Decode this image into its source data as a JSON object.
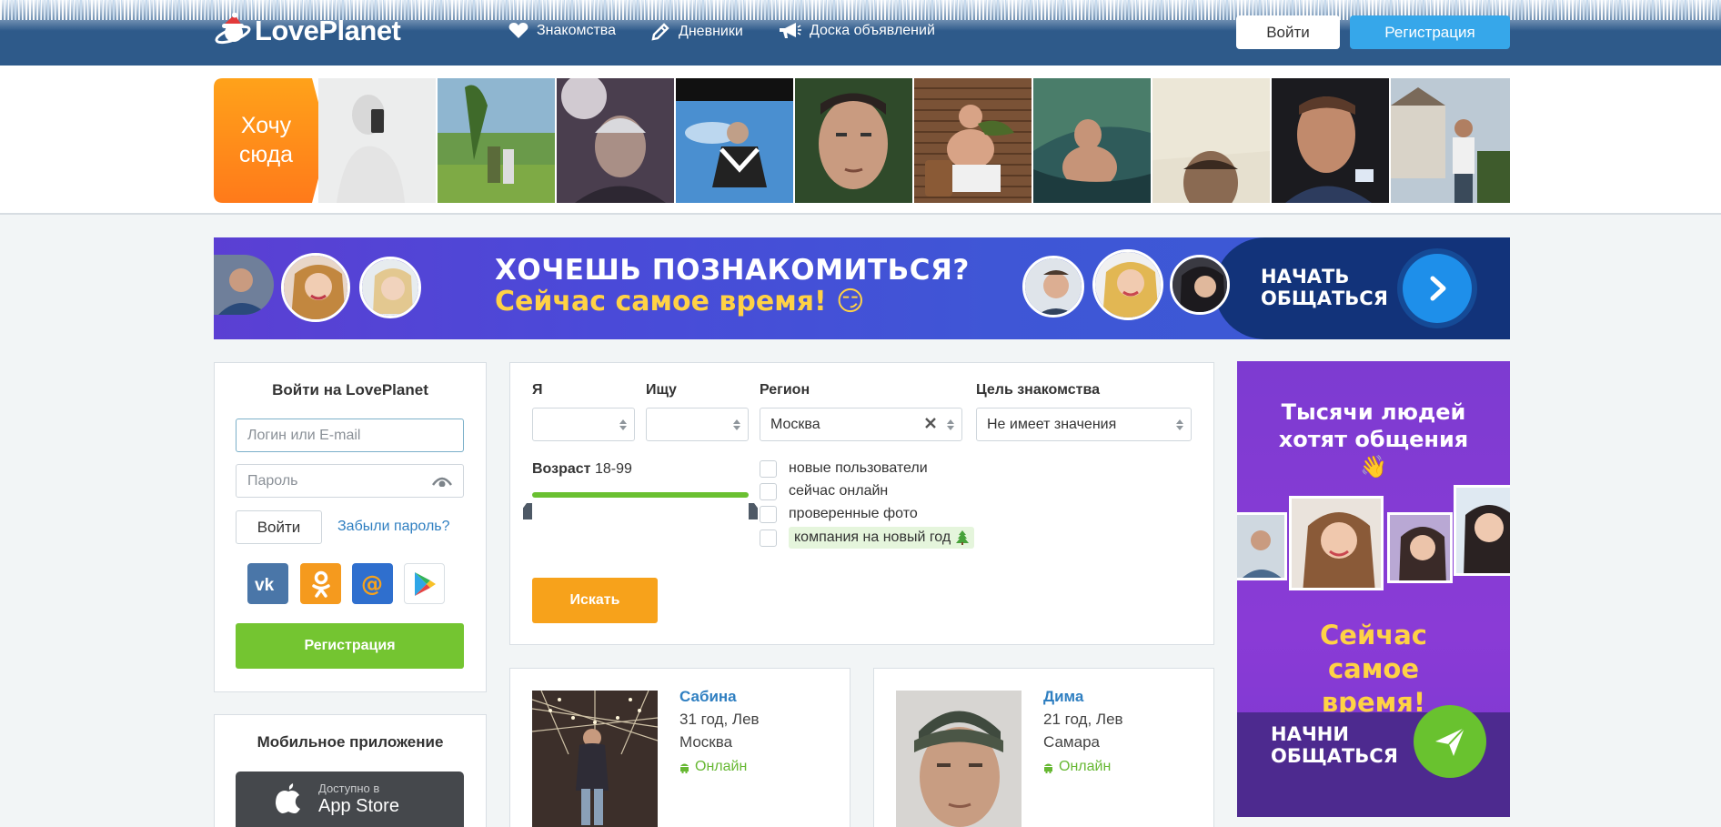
{
  "header": {
    "logo_text": "LovePlanet",
    "nav": [
      {
        "label": "Знакомства",
        "icon": "heart-icon"
      },
      {
        "label": "Дневники",
        "icon": "pencil-icon"
      },
      {
        "label": "Доска объявлений",
        "icon": "megaphone-icon"
      }
    ],
    "login_label": "Войти",
    "register_label": "Регистрация"
  },
  "strip": {
    "want_here": "Хочу сюда"
  },
  "banner": {
    "title": "ХОЧЕШЬ ПОЗНАКОМИТЬСЯ?",
    "subtitle": "Сейчас самое время! 😏",
    "cta": "НАЧАТЬ ОБЩАТЬСЯ"
  },
  "login_panel": {
    "title": "Войти на LovePlanet",
    "login_placeholder": "Логин или E-mail",
    "password_placeholder": "Пароль",
    "enter_label": "Войти",
    "forgot_label": "Забыли пароль?",
    "social": [
      "vk-icon",
      "odnoklassniki-icon",
      "mailru-icon",
      "google-play-icon"
    ],
    "register_label": "Регистрация"
  },
  "mobile_panel": {
    "title": "Мобильное приложение",
    "appstore_small": "Доступно в",
    "appstore_big": "App Store"
  },
  "search": {
    "labels": {
      "me": "Я",
      "seek": "Ищу",
      "region": "Регион",
      "goal": "Цель знакомства"
    },
    "me_value": "",
    "seek_value": "",
    "region_value": "Москва",
    "goal_value": "Не имеет значения",
    "age_label": "Возраст",
    "age_range": "18-99",
    "age_min": 18,
    "age_max": 99,
    "checkboxes": [
      {
        "label": "новые пользователи",
        "checked": false
      },
      {
        "label": "сейчас онлайн",
        "checked": false
      },
      {
        "label": "проверенные фото",
        "checked": false
      },
      {
        "label": "компания на новый год",
        "checked": false
      }
    ],
    "search_label": "Искать"
  },
  "profiles": [
    {
      "name": "Сабина",
      "info": "31 год, Лев",
      "city": "Москва",
      "status": "Онлайн"
    },
    {
      "name": "Дима",
      "info": "21 год, Лев",
      "city": "Самара",
      "status": "Онлайн"
    }
  ],
  "side_ad": {
    "title": "Тысячи людей хотят общения 👋",
    "middle": "Сейчас самое время!",
    "cta": "НАЧНИ ОБЩАТЬСЯ"
  },
  "colors": {
    "header_blue": "#2e5a8a",
    "accent_blue": "#36a7ea",
    "green": "#74c531",
    "orange": "#f7a21b",
    "link": "#2f7fc1"
  }
}
